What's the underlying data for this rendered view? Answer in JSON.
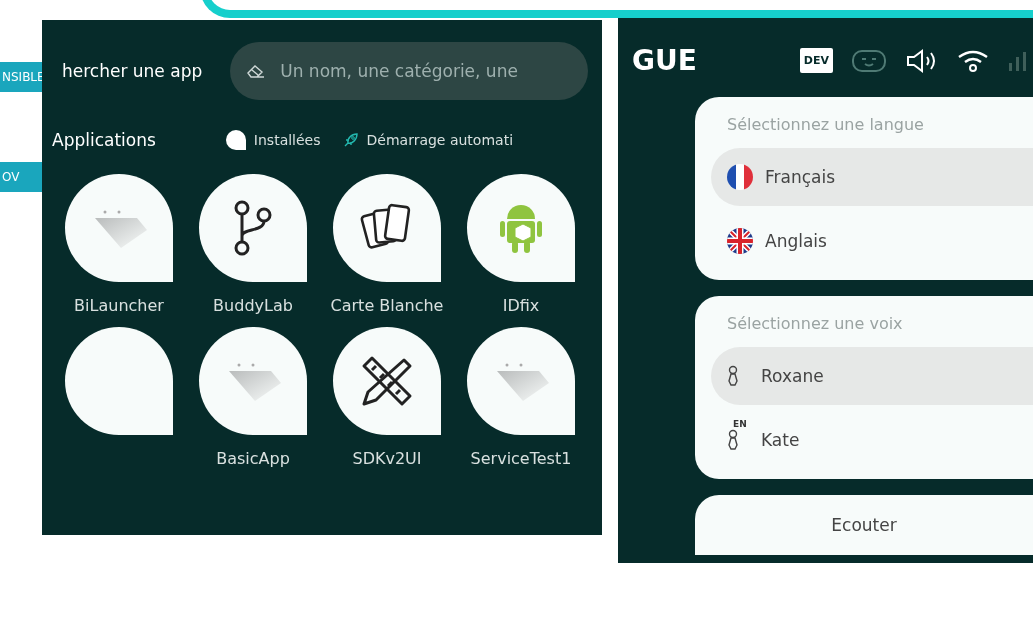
{
  "side_tags": [
    "NSIBLE",
    "OV"
  ],
  "apps_screen": {
    "search_label": "hercher une app",
    "search": {
      "placeholder": "Un nom, une catégorie, une"
    },
    "section_title": "Applications",
    "filters": [
      {
        "kind": "installed",
        "label": "Installées"
      },
      {
        "kind": "autostart",
        "label": "Démarrage automati"
      }
    ],
    "apps": [
      {
        "kind": "app",
        "name": "BiLauncher"
      },
      {
        "kind": "app",
        "name": "BuddyLab"
      },
      {
        "kind": "app",
        "name": "Carte Blanche"
      },
      {
        "kind": "app",
        "name": "IDfix"
      },
      {
        "kind": "app"
      },
      {
        "kind": "app",
        "name": "BasicApp"
      },
      {
        "kind": "app",
        "name": "SDKv2UI"
      },
      {
        "kind": "app",
        "name": "ServiceTest1"
      }
    ]
  },
  "language_screen": {
    "title": "GUE",
    "dev_badge": "DEV",
    "language_card": {
      "heading": "Sélectionnez une langue",
      "options": [
        {
          "label": "Français",
          "selected": true
        },
        {
          "label": "Anglais",
          "selected": false
        }
      ]
    },
    "voice_card": {
      "heading": "Sélectionnez une voix",
      "options": [
        {
          "name": "Roxane",
          "selected": true
        },
        {
          "name": "Kate",
          "lang_badge": "EN",
          "selected": false
        }
      ]
    },
    "listen_button": "Ecouter"
  }
}
